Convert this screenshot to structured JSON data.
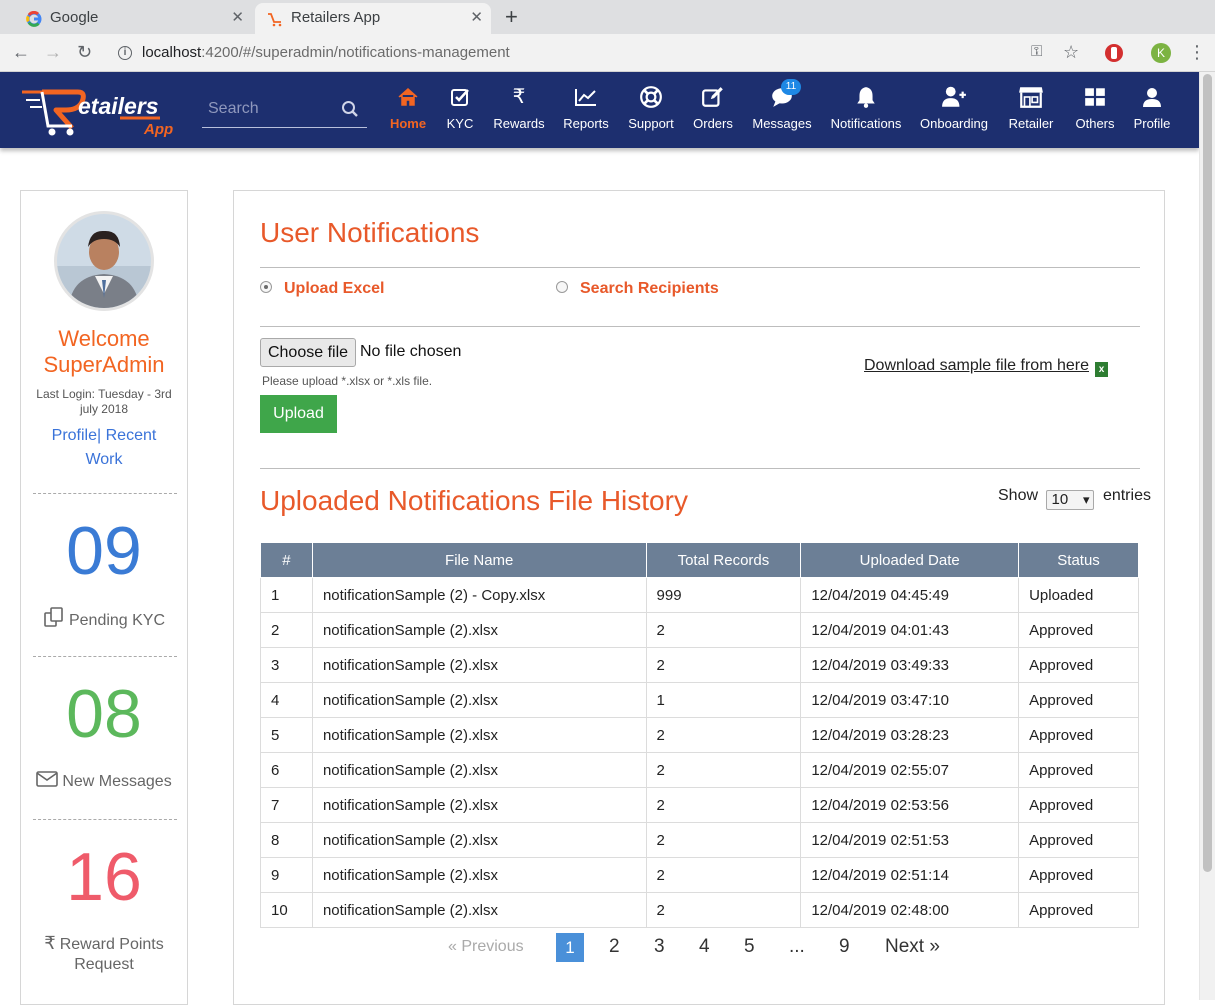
{
  "browser": {
    "tabs": [
      {
        "title": "Google"
      },
      {
        "title": "Retailers App"
      }
    ],
    "url_host": "localhost",
    "url_rest": ":4200/#/superadmin/notifications-management",
    "profile_initial": "K"
  },
  "app": {
    "logo_text": "Retailers",
    "logo_sub": "App",
    "search_placeholder": "Search",
    "nav": [
      {
        "label": "Home",
        "icon": "home-icon",
        "active": true
      },
      {
        "label": "KYC",
        "icon": "check-square-icon"
      },
      {
        "label": "Rewards",
        "icon": "rupee-icon"
      },
      {
        "label": "Reports",
        "icon": "line-chart-icon"
      },
      {
        "label": "Support",
        "icon": "life-ring-icon"
      },
      {
        "label": "Orders",
        "icon": "edit-icon"
      },
      {
        "label": "Messages",
        "icon": "chat-icon",
        "badge": "11"
      },
      {
        "label": "Notifications",
        "icon": "bell-icon"
      },
      {
        "label": "Onboarding",
        "icon": "user-plus-icon"
      },
      {
        "label": "Retailer",
        "icon": "store-icon"
      },
      {
        "label": "Others",
        "icon": "grid-icon"
      },
      {
        "label": "Profile",
        "icon": "user-icon"
      }
    ]
  },
  "sidebar": {
    "welcome_line1": "Welcome",
    "welcome_line2": "SuperAdmin",
    "last_login": "Last Login: Tuesday - 3rd july 2018",
    "profile_link": "Profile|",
    "recent_link": "Recent Work",
    "stats": [
      {
        "value": "09",
        "label": "Pending KYC",
        "color": "#3a7bd5",
        "icon": "copy-icon"
      },
      {
        "value": "08",
        "label": "New Messages",
        "color": "#5cb85c",
        "icon": "envelope-icon"
      },
      {
        "value": "16",
        "label": "Reward Points Request",
        "color": "#ef5b6a",
        "icon": "rupee-icon"
      }
    ]
  },
  "main": {
    "title": "User Notifications",
    "radio_upload": "Upload Excel",
    "radio_search": "Search Recipients",
    "choose_file": "Choose file",
    "no_file": "No file chosen",
    "file_hint": "Please upload *.xlsx or *.xls file.",
    "upload_button": "Upload",
    "download_link": "Download sample file from here",
    "history_title": "Uploaded Notifications File History",
    "show_label": "Show",
    "show_value": "10",
    "entries_label": "entries",
    "table": {
      "headers": [
        "#",
        "File Name",
        "Total Records",
        "Uploaded Date",
        "Status"
      ],
      "rows": [
        [
          "1",
          "notificationSample (2) - Copy.xlsx",
          "999",
          "12/04/2019 04:45:49",
          "Uploaded"
        ],
        [
          "2",
          "notificationSample (2).xlsx",
          "2",
          "12/04/2019 04:01:43",
          "Approved"
        ],
        [
          "3",
          "notificationSample (2).xlsx",
          "2",
          "12/04/2019 03:49:33",
          "Approved"
        ],
        [
          "4",
          "notificationSample (2).xlsx",
          "1",
          "12/04/2019 03:47:10",
          "Approved"
        ],
        [
          "5",
          "notificationSample (2).xlsx",
          "2",
          "12/04/2019 03:28:23",
          "Approved"
        ],
        [
          "6",
          "notificationSample (2).xlsx",
          "2",
          "12/04/2019 02:55:07",
          "Approved"
        ],
        [
          "7",
          "notificationSample (2).xlsx",
          "2",
          "12/04/2019 02:53:56",
          "Approved"
        ],
        [
          "8",
          "notificationSample (2).xlsx",
          "2",
          "12/04/2019 02:51:53",
          "Approved"
        ],
        [
          "9",
          "notificationSample (2).xlsx",
          "2",
          "12/04/2019 02:51:14",
          "Approved"
        ],
        [
          "10",
          "notificationSample (2).xlsx",
          "2",
          "12/04/2019 02:48:00",
          "Approved"
        ]
      ]
    },
    "pager": {
      "previous": "«  Previous",
      "pages": [
        "1",
        "2",
        "3",
        "4",
        "5",
        "...",
        "9"
      ],
      "current": "1",
      "next": "Next  »"
    }
  },
  "colors": {
    "navbar": "#1d2f6f",
    "accent": "#e8592a",
    "upload": "#3fa64a",
    "table_header": "#6c7f96"
  }
}
